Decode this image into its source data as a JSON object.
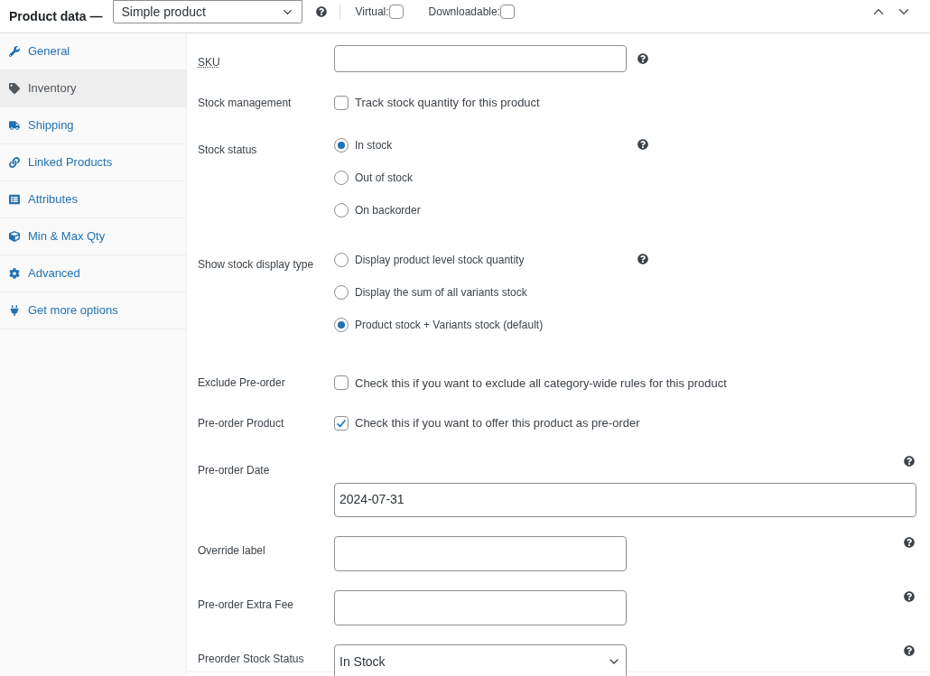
{
  "header": {
    "title": "Product data —",
    "product_type": "Simple product",
    "options": [
      {
        "label": "Virtual:",
        "checked": false
      },
      {
        "label": "Downloadable:",
        "checked": false
      }
    ]
  },
  "sidebar": {
    "items": [
      {
        "label": "General",
        "selected": false
      },
      {
        "label": "Inventory",
        "selected": true
      },
      {
        "label": "Shipping",
        "selected": false
      },
      {
        "label": "Linked Products",
        "selected": false
      },
      {
        "label": "Attributes",
        "selected": false
      },
      {
        "label": "Min & Max Qty",
        "selected": false
      },
      {
        "label": "Advanced",
        "selected": false
      },
      {
        "label": "Get more options",
        "selected": false
      }
    ]
  },
  "stock_fields": [
    {
      "kind": "text",
      "label": "SKU",
      "abbreviation": true,
      "help": true
    },
    {
      "kind": "checkbox",
      "label": "Stock management",
      "text": "Track stock quantity for this product",
      "checked": false,
      "help": false
    },
    {
      "kind": "radio",
      "label": "Stock status",
      "help": true,
      "options": [
        {
          "label": "In stock",
          "selected": true
        },
        {
          "label": "Out of stock",
          "selected": false
        },
        {
          "label": "On backorder",
          "selected": false
        }
      ]
    },
    {
      "kind": "radio",
      "label": "Show stock display type",
      "help": true,
      "options": [
        {
          "label": "Display product level stock quantity",
          "selected": false
        },
        {
          "label": "Display the sum of all variants stock",
          "selected": false
        },
        {
          "label": "Product stock + Variants stock (default)",
          "selected": true
        }
      ]
    }
  ],
  "preorder_fields": [
    {
      "kind": "checkbox",
      "label": "Exclude Pre-order",
      "text": "Check this if you want to exclude all category-wide rules for this product",
      "checked": false,
      "help": false
    },
    {
      "kind": "checkbox",
      "label": "Pre-order Product",
      "text": "Check this if you want to offer this product as pre-order",
      "checked": true,
      "help": false
    },
    {
      "kind": "date",
      "label": "Pre-order Date",
      "value": "2024-07-31",
      "help": true
    },
    {
      "kind": "text",
      "label": "Override label",
      "help": true
    },
    {
      "kind": "text",
      "label": "Pre-order Extra Fee",
      "help": true
    },
    {
      "kind": "select",
      "label": "Preorder Stock Status",
      "value": "In Stock",
      "help": true
    }
  ]
}
